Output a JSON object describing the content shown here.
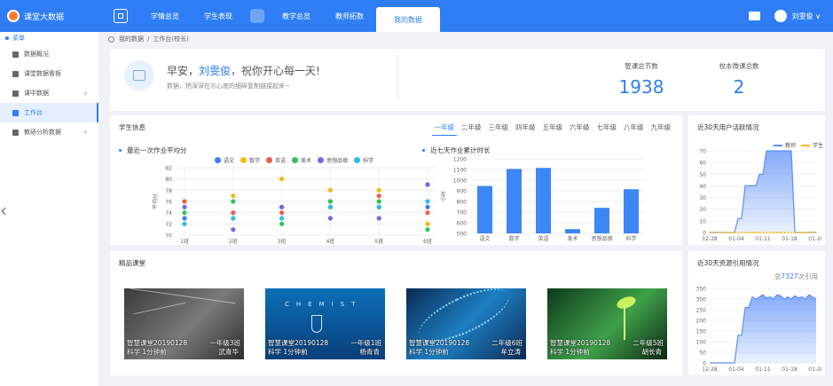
{
  "header": {
    "app_title": "课堂大数据",
    "nav": [
      "学情总览",
      "学生表现",
      "教学总览",
      "教师拓数",
      "我的数据"
    ],
    "active_nav": 4,
    "user": "刘雯俊 ∨"
  },
  "sidebar": {
    "head": "菜单",
    "items": [
      {
        "label": "数据概况",
        "chevron": ""
      },
      {
        "label": "课堂数据看板",
        "chevron": ""
      },
      {
        "label": "课中数据",
        "chevron": "∨"
      },
      {
        "label": "工作台",
        "chevron": ""
      },
      {
        "label": "教研分析数据",
        "chevron": "∨"
      }
    ],
    "active_index": 3,
    "collapse_glyph": "‹"
  },
  "breadcrumb": {
    "root": "我的数据",
    "sep": "/",
    "current": "工作台(校长)"
  },
  "welcome": {
    "greet_prefix": "早安，",
    "name": "刘雯俊",
    "greet_suffix": "，祝你开心每一天!",
    "subtitle": "数据，把深深在忘心底的细碎复制链接起来~",
    "stats": [
      {
        "label": "智课总节数",
        "value": "1938"
      },
      {
        "label": "校本微课总数",
        "value": "2"
      }
    ]
  },
  "student_info": {
    "title": "学生信息",
    "grades": [
      "一年级",
      "二年级",
      "三年级",
      "四年级",
      "五年级",
      "六年级",
      "七年级",
      "八年级",
      "九年级"
    ],
    "active_grade": 0,
    "scatter_title": "最近一次作业平均分",
    "bar_title": "近七天作业累计时长"
  },
  "user_activity": {
    "title": "近30天用户活跃情况",
    "legend": [
      "教师",
      "学生"
    ],
    "colors": [
      "#5b8ff9",
      "#f6bd16"
    ]
  },
  "resource_usage": {
    "title": "近30天资源引用情况",
    "total_prefix": "总",
    "total_value": "7327",
    "total_suffix": "次引用"
  },
  "courses": {
    "title": "精品课堂",
    "items": [
      {
        "line1": "智慧课堂20190128",
        "line2": "科学 1分钟前",
        "class": "一年级3班",
        "teacher": "武青华",
        "palette": "chalk"
      },
      {
        "line1": "智慧课堂20190128",
        "line2": "科学 1分钟前",
        "class": "一年级1班",
        "teacher": "杨青青",
        "palette": "chem"
      },
      {
        "line1": "智慧课堂20190128",
        "line2": "科学 1分钟前",
        "class": "二年级6班",
        "teacher": "牟立涛",
        "palette": "dna"
      },
      {
        "line1": "智慧课堂20190128",
        "line2": "科学 1分钟前",
        "class": "二年级5班",
        "teacher": "胡长青",
        "palette": "sprout"
      }
    ],
    "chem_word": "CHEMIST"
  },
  "chart_data": [
    {
      "type": "scatter",
      "title": "最近一次作业平均分",
      "ylabel": "平均分",
      "categories": [
        "1班",
        "2班",
        "3班",
        "4班",
        "5班",
        "6班"
      ],
      "ylim": [
        70,
        82
      ],
      "yticks": [
        70,
        72,
        74,
        76,
        78,
        80,
        82
      ],
      "series": [
        {
          "name": "语文",
          "color": "#3d7df5",
          "values": [
            73,
            74,
            75,
            75,
            75,
            75
          ]
        },
        {
          "name": "数学",
          "color": "#f6b915",
          "values": [
            76,
            77,
            80,
            78,
            78,
            72
          ]
        },
        {
          "name": "英语",
          "color": "#f05e4d",
          "values": [
            76,
            74,
            74,
            76,
            77,
            74
          ]
        },
        {
          "name": "美术",
          "color": "#2fc25b",
          "values": [
            74,
            76,
            72,
            76,
            76,
            71
          ]
        },
        {
          "name": "思想品德",
          "color": "#7366e8",
          "values": [
            75,
            71,
            75,
            73,
            73,
            79
          ]
        },
        {
          "name": "科学",
          "color": "#2dbbe8",
          "values": [
            72,
            73,
            73,
            75,
            75,
            76
          ]
        }
      ]
    },
    {
      "type": "bar",
      "title": "近七天作业累计时长",
      "ylabel": "小时",
      "categories": [
        "语文",
        "数学",
        "英语",
        "美术",
        "思想品德",
        "科学"
      ],
      "values": [
        945,
        1105,
        1115,
        540,
        740,
        915
      ],
      "ylim": [
        500,
        1200
      ],
      "yticks": [
        500,
        600,
        700,
        800,
        900,
        1000,
        1100,
        1200
      ],
      "color": "#3d86f6"
    },
    {
      "type": "area",
      "title": "近30天用户活跃情况",
      "x_ticks": [
        "12-28",
        "01-04",
        "01-11",
        "01-18",
        "01-28"
      ],
      "ylim": [
        0,
        70
      ],
      "yticks": [
        0,
        10,
        20,
        30,
        40,
        50,
        60,
        70
      ],
      "series": [
        {
          "name": "教师",
          "values": [
            0,
            0,
            0,
            0,
            0,
            0,
            0,
            0,
            12,
            12,
            40,
            40,
            40,
            40,
            50,
            50,
            70,
            70,
            70,
            70,
            70,
            70,
            70,
            70,
            0,
            0,
            0,
            0,
            0,
            0,
            0
          ]
        },
        {
          "name": "学生",
          "values": [
            0,
            0,
            0,
            0,
            0,
            0,
            0,
            0,
            0,
            0,
            0,
            0,
            0,
            0,
            0,
            0,
            0,
            0,
            0,
            0,
            0,
            0,
            0,
            0,
            0,
            0,
            0,
            0,
            0,
            0,
            0
          ]
        }
      ]
    },
    {
      "type": "area",
      "title": "近30天资源引用情况",
      "x_ticks": [
        "12-28",
        "01-04",
        "01-11",
        "01-18",
        "01-28"
      ],
      "ylim": [
        0,
        350
      ],
      "yticks": [
        0,
        50,
        100,
        150,
        200,
        250,
        300,
        350
      ],
      "values": [
        0,
        0,
        0,
        0,
        0,
        0,
        0,
        0,
        130,
        130,
        260,
        260,
        310,
        300,
        310,
        320,
        305,
        310,
        300,
        320,
        315,
        300,
        310,
        300,
        315,
        305,
        310,
        300,
        320,
        310,
        300
      ]
    }
  ]
}
